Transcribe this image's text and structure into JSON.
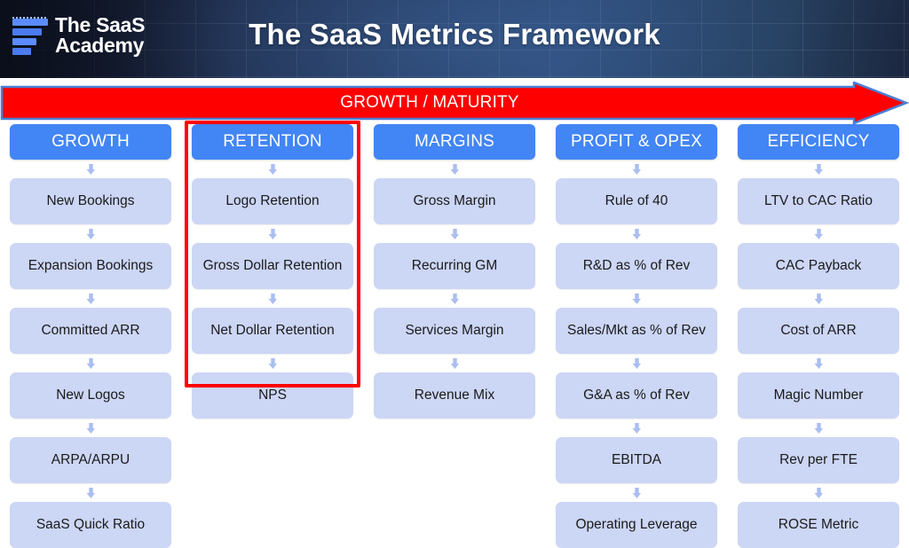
{
  "header": {
    "logo_text": "The SaaS\nAcademy",
    "logo_icon": "funnel-bars-logo",
    "title": "The SaaS Metrics Framework"
  },
  "banner": {
    "label": "GROWTH / MATURITY",
    "arrow_direction": "right",
    "fill_color": "#ff0000",
    "outline_color": "#4a7fd4"
  },
  "highlight": {
    "color": "#ff0000",
    "target_column": "RETENTION"
  },
  "colors": {
    "header_blue": "#4285f4",
    "cell_lavender": "#ccd6f5",
    "connector_blue": "#aabef0",
    "accent_red": "#ff0000",
    "logo_blue": "#4a7bf0"
  },
  "columns": [
    {
      "header": "GROWTH",
      "items": [
        "New Bookings",
        "Expansion Bookings",
        "Committed ARR",
        "New Logos",
        "ARPA/ARPU",
        "SaaS Quick Ratio"
      ]
    },
    {
      "header": "RETENTION",
      "items": [
        "Logo Retention",
        "Gross Dollar Retention",
        "Net Dollar Retention",
        "NPS"
      ]
    },
    {
      "header": "MARGINS",
      "items": [
        "Gross Margin",
        "Recurring GM",
        "Services Margin",
        "Revenue Mix"
      ]
    },
    {
      "header": "PROFIT & OPEX",
      "items": [
        "Rule of 40",
        "R&D as % of Rev",
        "Sales/Mkt as % of Rev",
        "G&A as % of Rev",
        "EBITDA",
        "Operating Leverage"
      ]
    },
    {
      "header": "EFFICIENCY",
      "items": [
        "LTV to CAC Ratio",
        "CAC Payback",
        "Cost of ARR",
        "Magic Number",
        "Rev per FTE",
        "ROSE Metric"
      ]
    }
  ]
}
